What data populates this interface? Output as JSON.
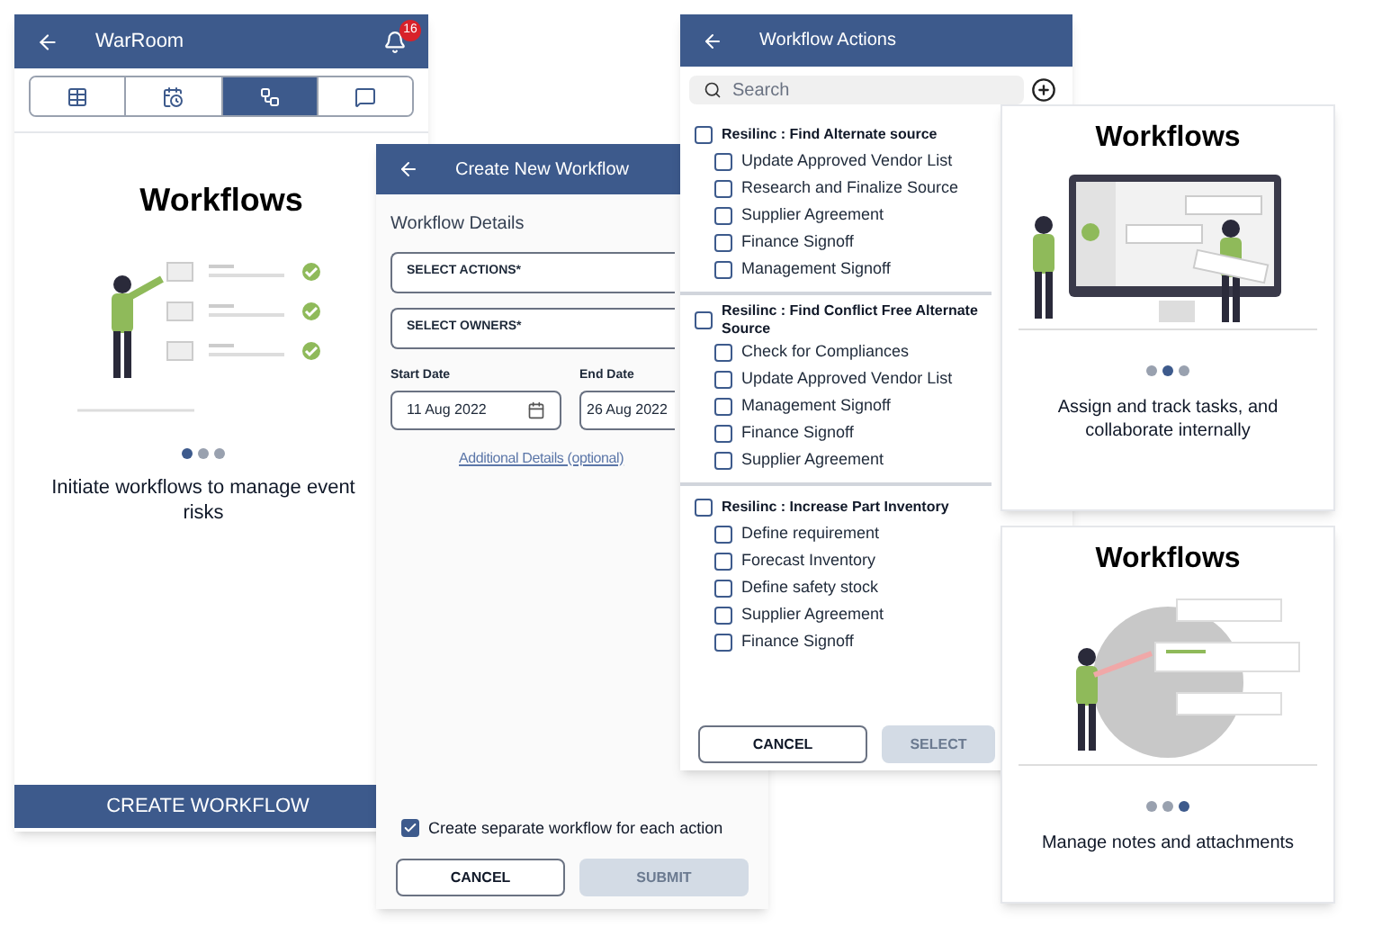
{
  "warroom_screen": {
    "title": "WarRoom",
    "notification_count": "16",
    "tabs": [
      {
        "kind": "table",
        "selected": false
      },
      {
        "kind": "calendar",
        "selected": false
      },
      {
        "kind": "workflow",
        "selected": true
      },
      {
        "kind": "chat",
        "selected": false
      }
    ],
    "heading": "Workflows",
    "illustration": {
      "kind": "checklist"
    },
    "carousel_dots": [
      {
        "selected": true
      },
      {
        "selected": false
      },
      {
        "selected": false
      }
    ],
    "description": "Initiate workflows to manage event risks",
    "button": "CREATE WORKFLOW"
  },
  "create_workflow_screen": {
    "title": "Create New Workflow",
    "section": "Workflow Details",
    "selects": [
      {
        "label": "SELECT ACTIONS*"
      },
      {
        "label": "SELECT OWNERS*"
      }
    ],
    "start_date": {
      "label": "Start Date",
      "value": "11 Aug 2022"
    },
    "end_date": {
      "label": "End Date",
      "value": "26 Aug 2022"
    },
    "link": "Additional Details (optional)",
    "option": {
      "label": "Create separate workflow for each action",
      "checked": true
    },
    "buttons": [
      {
        "label": "CANCEL",
        "disabled": false
      },
      {
        "label": "SUBMIT",
        "disabled": true
      }
    ]
  },
  "workflow_actions_screen": {
    "title": "Workflow Actions",
    "search": {
      "placeholder": "Search"
    },
    "groups": [
      {
        "label": "Resilinc : Find Alternate source",
        "checked": false,
        "children": [
          {
            "label": "Update Approved Vendor List",
            "checked": false
          },
          {
            "label": "Research and Finalize Source",
            "checked": false
          },
          {
            "label": "Supplier Agreement",
            "checked": false
          },
          {
            "label": "Finance Signoff",
            "checked": false
          },
          {
            "label": "Management Signoff",
            "checked": false
          }
        ]
      },
      {
        "label": "Resilinc : Find Conflict Free Alternate Source",
        "checked": false,
        "children": [
          {
            "label": "Check for Compliances",
            "checked": false
          },
          {
            "label": "Update Approved Vendor List",
            "checked": false
          },
          {
            "label": "Management Signoff",
            "checked": false
          },
          {
            "label": "Finance Signoff",
            "checked": false
          },
          {
            "label": "Supplier Agreement",
            "checked": false
          }
        ]
      },
      {
        "label": "Resilinc : Increase Part Inventory",
        "checked": false,
        "children": [
          {
            "label": "Define requirement",
            "checked": false
          },
          {
            "label": "Forecast Inventory",
            "checked": false
          },
          {
            "label": "Define safety stock",
            "checked": false
          },
          {
            "label": "Supplier Agreement",
            "checked": false
          },
          {
            "label": "Finance Signoff",
            "checked": false
          }
        ]
      }
    ],
    "buttons": [
      {
        "label": "CANCEL",
        "disabled": false
      },
      {
        "label": "SELECT",
        "disabled": true
      }
    ]
  },
  "cards": [
    {
      "heading": "Workflows",
      "illustration": {
        "kind": "monitor"
      },
      "carousel_dots": [
        {
          "selected": false
        },
        {
          "selected": true
        },
        {
          "selected": false
        }
      ],
      "description": "Assign and track tasks, and collaborate internally"
    },
    {
      "heading": "Workflows",
      "illustration": {
        "kind": "notes"
      },
      "carousel_dots": [
        {
          "selected": false
        },
        {
          "selected": false
        },
        {
          "selected": true
        }
      ],
      "description": "Manage notes and attachments"
    }
  ]
}
